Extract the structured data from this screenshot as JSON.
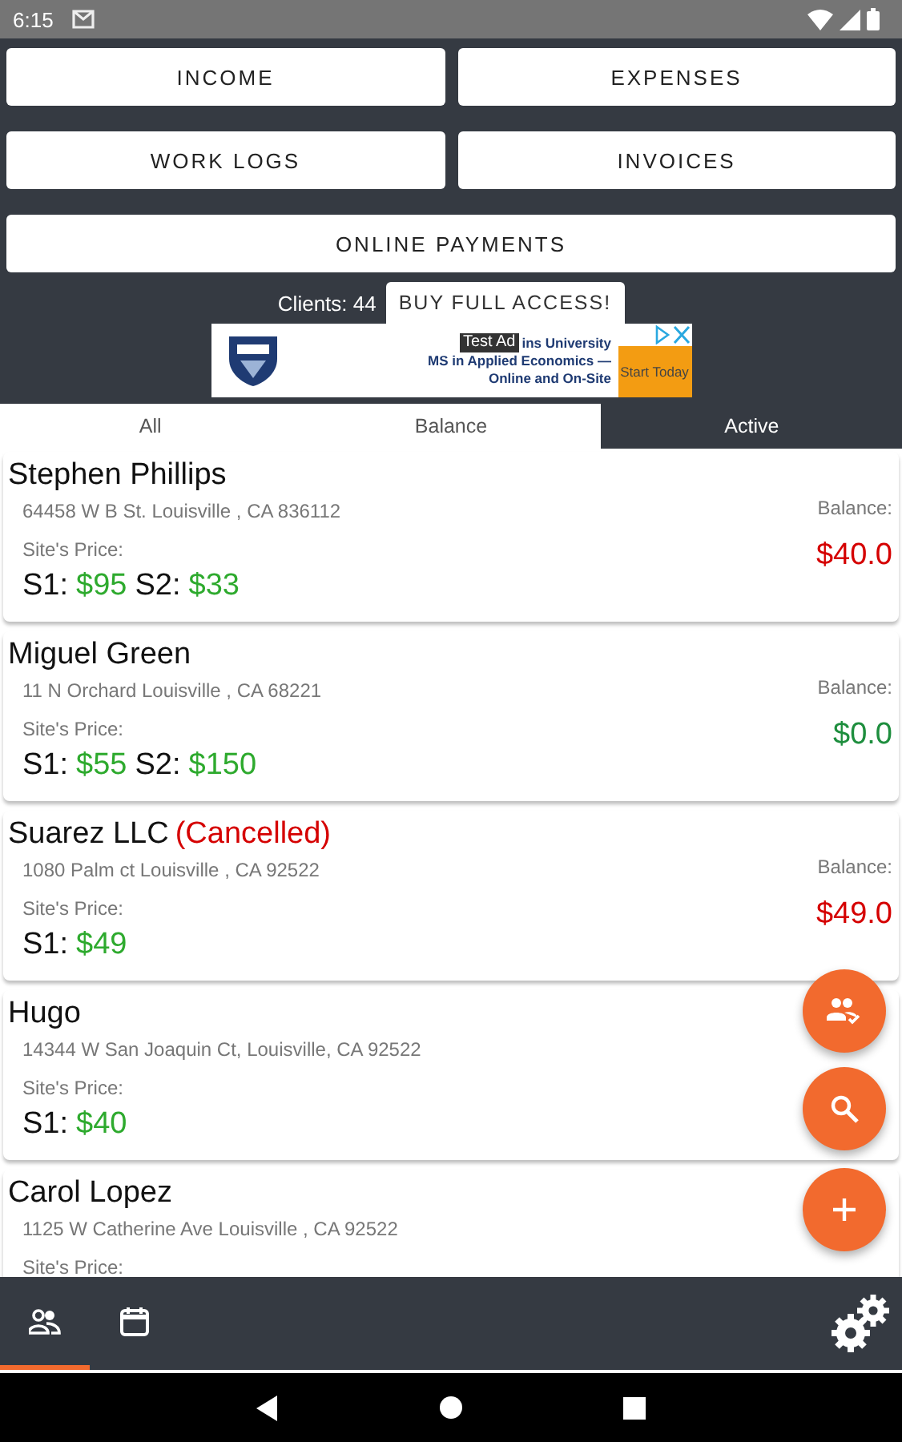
{
  "status_bar": {
    "time": "6:15"
  },
  "menu_buttons": [
    {
      "label": "INCOME"
    },
    {
      "label": "EXPENSES"
    },
    {
      "label": "WORK LOGS"
    },
    {
      "label": "INVOICES"
    },
    {
      "label": "ONLINE PAYMENTS"
    }
  ],
  "clients_count": "Clients: 44",
  "buy_button": "BUY FULL ACCESS!",
  "ad": {
    "badge": "Test Ad",
    "lines": [
      "ins University",
      "MS in Applied Economics —",
      "Online and On-Site"
    ],
    "cta": "Start Today"
  },
  "tabs": [
    {
      "label": "All",
      "selected": false
    },
    {
      "label": "Balance",
      "selected": false
    },
    {
      "label": "Active",
      "selected": true
    }
  ],
  "clients": [
    {
      "name": "Stephen Phillips",
      "address": "64458 W B St.  Louisville , CA  836112",
      "price_label": "Site's Price:",
      "prices": [
        {
          "label": "S1:",
          "value": "$95"
        },
        {
          "label": "S2:",
          "value": "$33"
        }
      ],
      "balance_label": "Balance:",
      "balance": "$40.0",
      "color": "#d50000"
    },
    {
      "name": "Miguel Green",
      "address": "11 N Orchard Louisville , CA 68221",
      "price_label": "Site's Price:",
      "prices": [
        {
          "label": "S1:",
          "value": "$55"
        },
        {
          "label": "S2:",
          "value": "$150"
        }
      ],
      "balance_label": "Balance:",
      "balance": "$0.0",
      "color": "#1e8e3e"
    },
    {
      "name": "Suarez LLC",
      "note": "(Cancelled)",
      "address": "1080 Palm ct Louisville , CA 92522",
      "price_label": "Site's Price:",
      "prices": [
        {
          "label": "S1:",
          "value": "$49"
        }
      ],
      "balance_label": "Balance:",
      "balance": "$49.0",
      "color": "#d50000"
    },
    {
      "name": "Hugo",
      "address": "14344 W San Joaquin Ct, Louisville, CA 92522",
      "price_label": "Site's Price:",
      "prices": [
        {
          "label": "S1:",
          "value": "$40"
        }
      ]
    },
    {
      "name": "Carol Lopez",
      "address": "1125 W Catherine Ave Louisville , CA 92522",
      "price_label": "Site's Price:"
    }
  ],
  "bottom_nav": [
    {
      "kind": "clients",
      "selected": true
    },
    {
      "kind": "calendar",
      "selected": false
    }
  ]
}
